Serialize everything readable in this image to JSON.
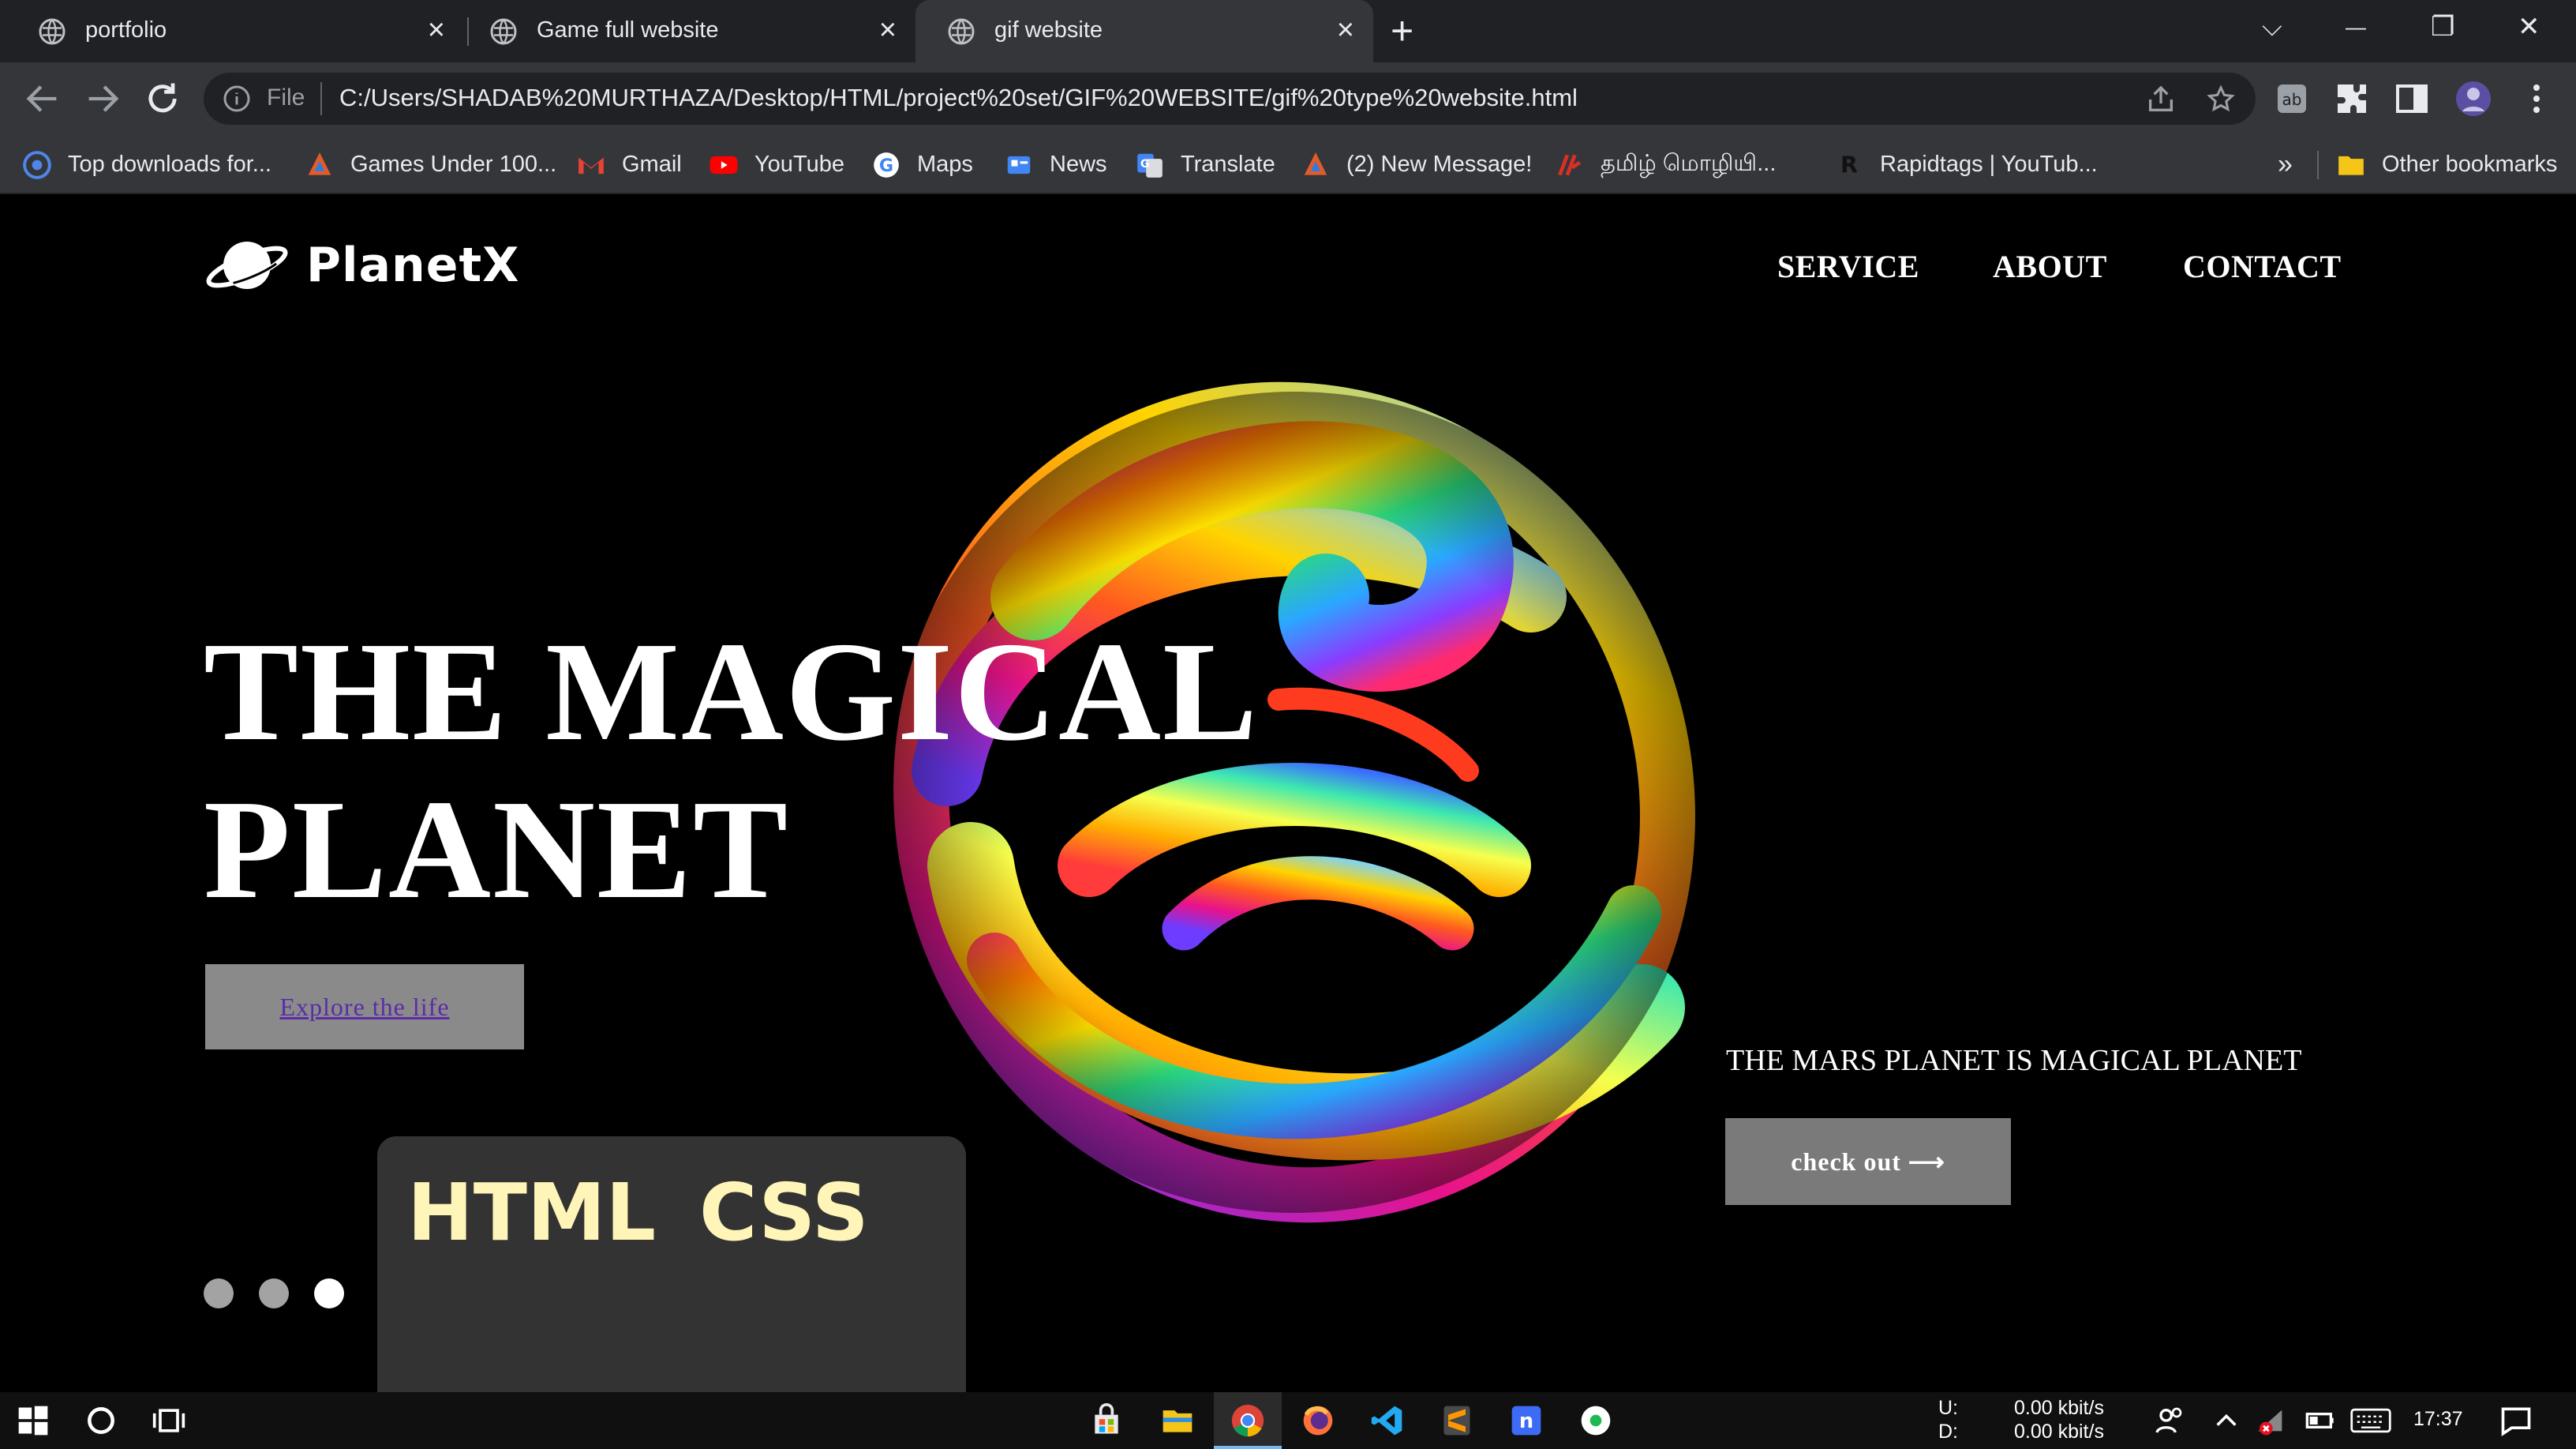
{
  "browser": {
    "tabs": [
      {
        "title": "portfolio",
        "active": false
      },
      {
        "title": "Game full website",
        "active": false
      },
      {
        "title": "gif website",
        "active": true
      }
    ],
    "new_tab_label": "+",
    "window_controls": {
      "tab_search": "⌵",
      "minimize": "—",
      "restore": "❐",
      "close": "✕"
    },
    "close_tab_glyph": "×"
  },
  "toolbar": {
    "scheme_label": "File",
    "url": "C:/Users/SHADAB%20MURTHAZA/Desktop/HTML/project%20set/GIF%20WEBSITE/gif%20type%20website.html"
  },
  "bookmarks": {
    "items": [
      {
        "label": "Top downloads for...",
        "icon": "download-favicon",
        "color": "#4f86ec"
      },
      {
        "label": "Games Under 100...",
        "icon": "game-favicon",
        "color": "#e25c2b"
      },
      {
        "label": "Gmail",
        "icon": "gmail-favicon",
        "color": "#ea4335"
      },
      {
        "label": "YouTube",
        "icon": "youtube-favicon",
        "color": "#ff0000"
      },
      {
        "label": "Maps",
        "icon": "google-favicon",
        "color": "#4285f4"
      },
      {
        "label": "News",
        "icon": "news-favicon",
        "color": "#4285f4"
      },
      {
        "label": "Translate",
        "icon": "translate-favicon",
        "color": "#4285f4"
      },
      {
        "label": "(2) New Message!",
        "icon": "message-favicon",
        "color": "#e25c2b"
      },
      {
        "label": "தமிழ் மொழியி...",
        "icon": "tamil-favicon",
        "color": "#d93025"
      },
      {
        "label": "Rapidtags | YouTub...",
        "icon": "rapidtags-favicon",
        "color": "#222222"
      }
    ],
    "overflow_label": "»",
    "other_label": "Other bookmarks"
  },
  "page": {
    "logo_text": "PlanetX",
    "nav": [
      "SERVICE",
      "ABOUT",
      "CONTACT"
    ],
    "hero_title_line1": "THE MAGICAL",
    "hero_title_line2": "PLANET",
    "explore_label": "Explore the life",
    "code_card": {
      "word1": "HTML",
      "word2": "CSS"
    },
    "slider_dots": [
      {
        "active": false
      },
      {
        "active": false
      },
      {
        "active": true
      }
    ],
    "mars_text": "THE MARS PLANET IS MAGICAL PLANET",
    "checkout_label": "check out ⟶"
  },
  "taskbar": {
    "net_upload_label": "U:",
    "net_download_label": "D:",
    "net_upload": "0.00 kbit/s",
    "net_download": "0.00 kbit/s",
    "time": "17:37"
  },
  "colors": {
    "chrome_dark": "#202124",
    "chrome_mid": "#35363a",
    "explore_text": "#5b2ca8",
    "code_text": "#fff5b8"
  }
}
